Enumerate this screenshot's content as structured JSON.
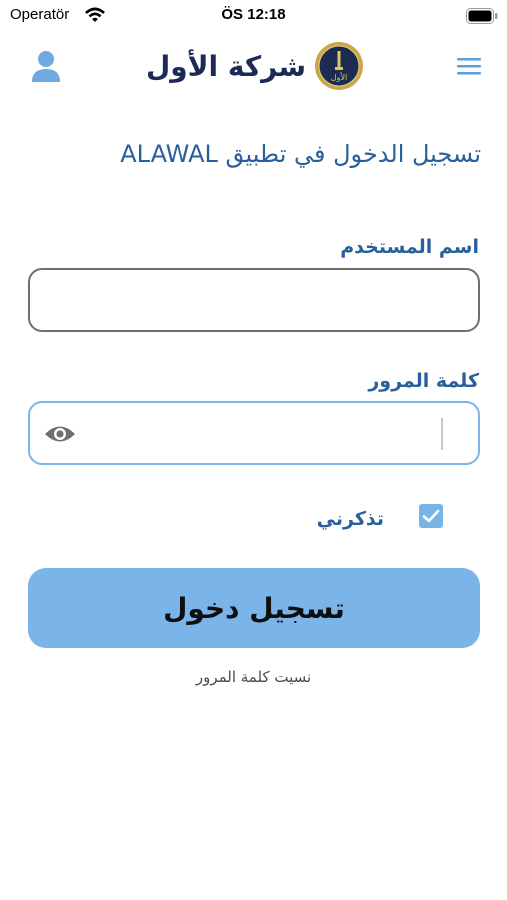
{
  "status_bar": {
    "carrier": "Operatör",
    "time": "ÖS 12:18"
  },
  "header": {
    "brand_name": "شركة الأول",
    "logo_text": "الأول",
    "icons": {
      "left": "user-icon",
      "right": "hamburger-menu-icon",
      "logo": "company-logo-icon"
    }
  },
  "login": {
    "title": "تسجيل الدخول في تطبيق ALAWAL",
    "username_label": "اسم المستخدم",
    "username_value": "",
    "password_label": "كلمة المرور",
    "password_value": "",
    "remember_label": "تذكرني",
    "remember_checked": true,
    "submit_label": "تسجيل دخول",
    "forgot_label": "نسيت كلمة المرور"
  },
  "colors": {
    "accent": "#2a5f9e",
    "button": "#7bb4e8",
    "checkbox": "#79b4e6",
    "brand_dark": "#1b2b55"
  }
}
